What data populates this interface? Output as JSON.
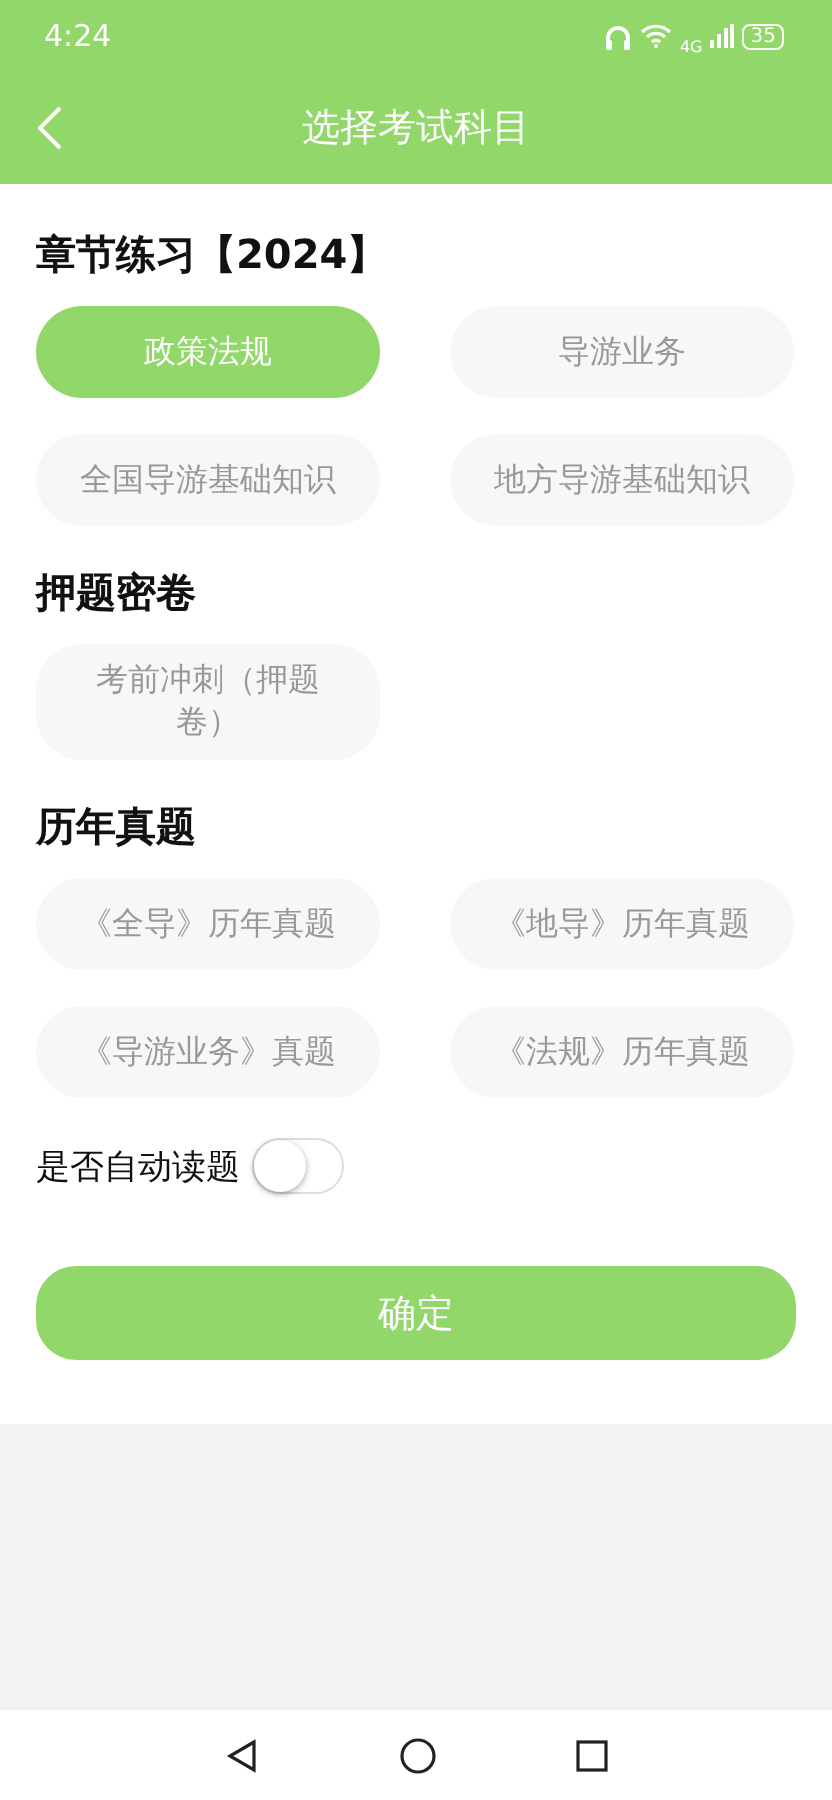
{
  "status_bar": {
    "time": "4:24",
    "network": "4G",
    "battery": "35"
  },
  "header": {
    "title": "选择考试科目"
  },
  "sections": [
    {
      "title": "章节练习【2024】",
      "options": [
        {
          "label": "政策法规",
          "selected": true
        },
        {
          "label": "导游业务",
          "selected": false
        },
        {
          "label": "全国导游基础知识",
          "selected": false
        },
        {
          "label": "地方导游基础知识",
          "selected": false
        }
      ]
    },
    {
      "title": "押题密卷",
      "options": [
        {
          "label": "考前冲刺（押题卷）",
          "selected": false
        }
      ]
    },
    {
      "title": "历年真题",
      "options": [
        {
          "label": "《全导》历年真题",
          "selected": false
        },
        {
          "label": "《地导》历年真题",
          "selected": false
        },
        {
          "label": "《导游业务》真题",
          "selected": false
        },
        {
          "label": "《法规》历年真题",
          "selected": false
        }
      ]
    }
  ],
  "auto_read": {
    "label": "是否自动读题",
    "on": false
  },
  "confirm_button": "确定"
}
